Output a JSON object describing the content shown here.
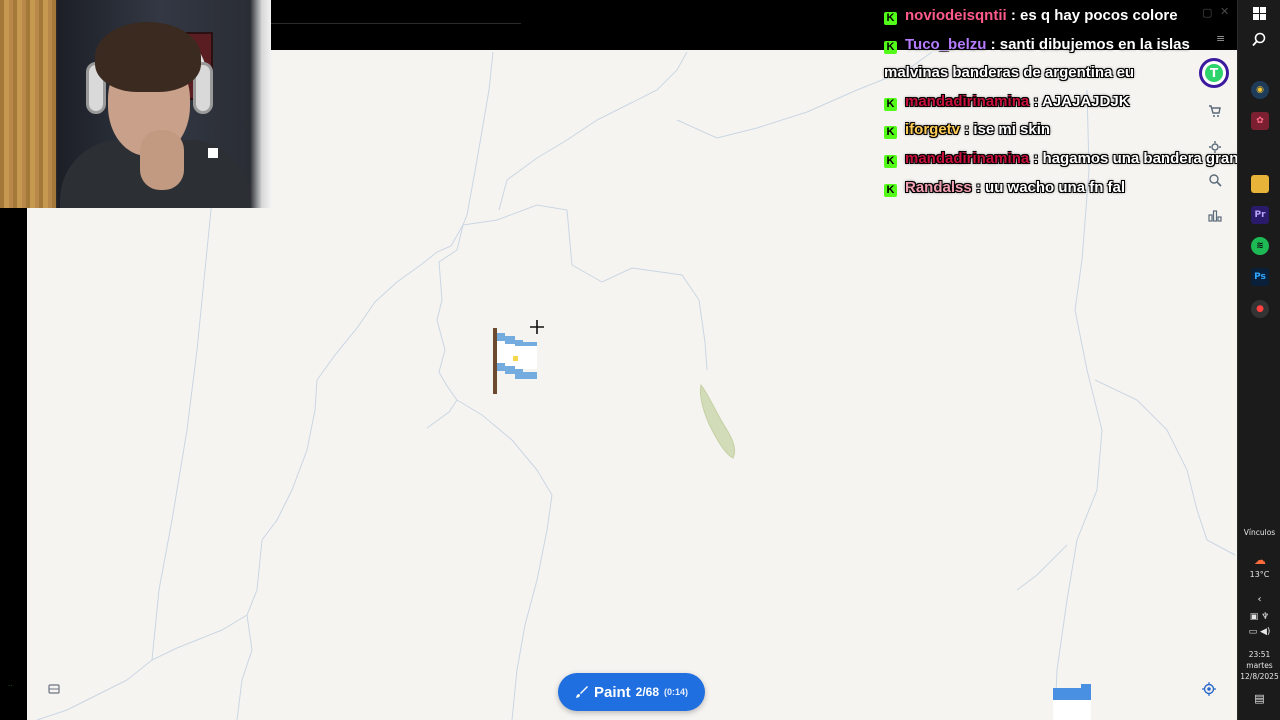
{
  "chat": {
    "messages": [
      {
        "user": "noviodeisqntii",
        "text": "es q hay pocos colore",
        "color": "#ff5a8a"
      },
      {
        "user": "Tuco_belzu",
        "text": "santi dibujemos en la islas malvinas banderas de argentina eu",
        "color": "#b57cff"
      },
      {
        "user": "mandadirinamina",
        "text": "AJAJAJDJK",
        "color": "#c8103c"
      },
      {
        "user": "iforgetv",
        "text": "ise mi skin",
        "color": "#ffcc55"
      },
      {
        "user": "mandadirinamina",
        "text": "hagamos una bandera grande",
        "color": "#c8103c"
      },
      {
        "user": "Randalss",
        "text": "uu wacho una fn fal",
        "color": "#f2a1b3"
      }
    ],
    "badge_glyph": "K",
    "badge_color": "#53fc18",
    "separator": ":"
  },
  "paint": {
    "label": "Paint",
    "count": "2/68",
    "timer": "(0:14)",
    "icon": "brush-icon",
    "color": "#1f6fe0"
  },
  "taskbar": {
    "links_label": "Vínculos",
    "temperature": "13°C",
    "time": "23:51",
    "day": "martes",
    "date": "12/8/2025"
  },
  "map": {
    "background": "#f6f4f1",
    "flag_colors": [
      "#74acdf",
      "#ffffff",
      "#f6b40e"
    ]
  }
}
